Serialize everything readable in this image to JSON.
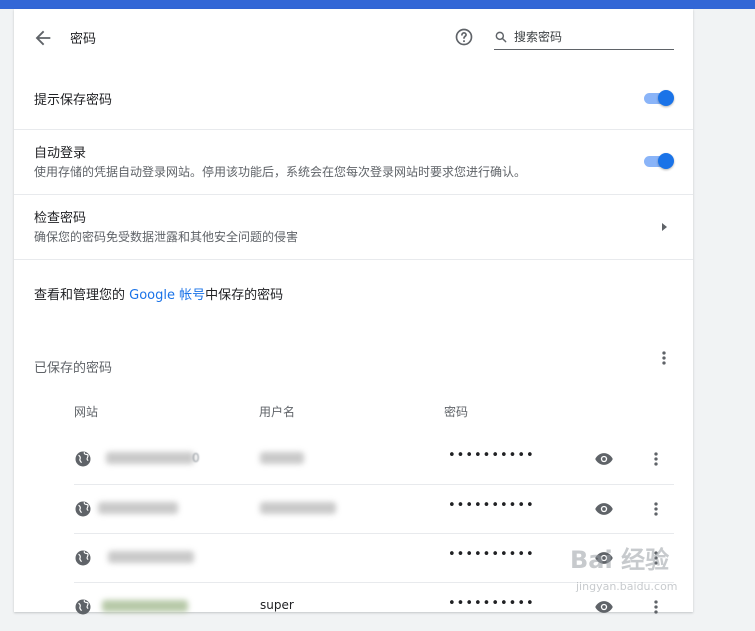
{
  "header": {
    "title": "密码",
    "search_placeholder": "搜索密码"
  },
  "settings": {
    "offer_to_save": {
      "label": "提示保存密码",
      "enabled": true
    },
    "auto_signin": {
      "label": "自动登录",
      "description": "使用存储的凭据自动登录网站。停用该功能后，系统会在您每次登录网站时要求您进行确认。",
      "enabled": true
    },
    "check_passwords": {
      "label": "检查密码",
      "description": "确保您的密码免受数据泄露和其他安全问题的侵害"
    }
  },
  "account_line": {
    "prefix": "查看和管理您的 ",
    "link": "Google 帐号",
    "suffix": "中保存的密码"
  },
  "saved": {
    "title": "已保存的密码",
    "columns": {
      "site": "网站",
      "username": "用户名",
      "password": "密码"
    },
    "rows": [
      {
        "site_visible": "0",
        "username": "",
        "password": "••••••••••"
      },
      {
        "site_visible": "",
        "username": "",
        "password": "••••••••••"
      },
      {
        "site_visible": "",
        "username": "",
        "password": "••••••••••"
      },
      {
        "site_visible": "",
        "username": "super",
        "password": "••••••••••"
      }
    ]
  },
  "watermark": {
    "logo": "Bai  经验",
    "url": "jingyan.baidu.com"
  },
  "colors": {
    "accent": "#1a73e8",
    "topbar": "#3367d6",
    "toggle_track": "#8ab4f8"
  },
  "icons": [
    "back-arrow-icon",
    "help-icon",
    "search-icon",
    "chevron-right-icon",
    "more-vert-icon",
    "globe-icon",
    "eye-icon"
  ]
}
